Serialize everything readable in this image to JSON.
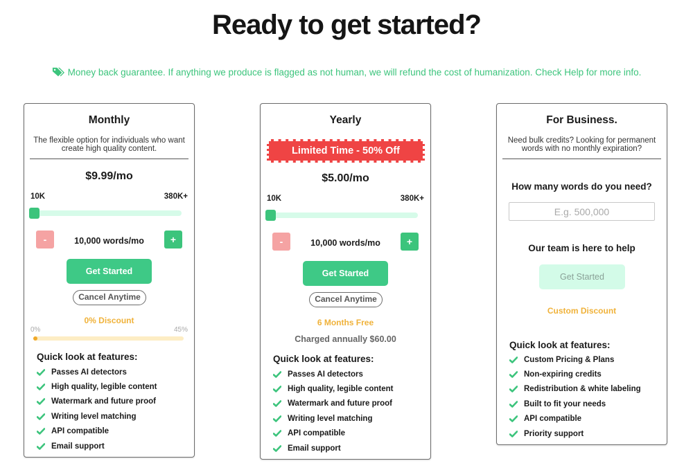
{
  "header": {
    "title": "Ready to get started?",
    "guarantee": "Money back guarantee. If anything we produce is flagged as not human, we will refund the cost of humanization. Check Help for more info.",
    "guarantee_icon": "tags-icon"
  },
  "colors": {
    "accent_green": "#3cc47c",
    "light_green": "#d6fbe9",
    "minus_red": "#f5a3a3",
    "banner_red": "#ef4444",
    "discount_orange": "#f0b23a"
  },
  "plans": {
    "monthly": {
      "title": "Monthly",
      "description": "The flexible option for individuals who want create high quality content.",
      "price": "$9.99/mo",
      "range_min": "10K",
      "range_max": "380K+",
      "slider_value_fraction": 0,
      "minus_label": "-",
      "plus_label": "+",
      "words": "10,000 words/mo",
      "cta": "Get Started",
      "cancel": "Cancel Anytime",
      "discount": "0% Discount",
      "discount_min": "0%",
      "discount_max": "45%",
      "discount_fraction": 0,
      "features_title": "Quick look at features:",
      "features": [
        "Passes AI detectors",
        "High quality, legible content",
        "Watermark and future proof",
        "Writing level matching",
        "API compatible",
        "Email support"
      ]
    },
    "yearly": {
      "title": "Yearly",
      "banner": "Limited Time - 50% Off",
      "price": "$5.00/mo",
      "range_min": "10K",
      "range_max": "380K+",
      "slider_value_fraction": 0,
      "minus_label": "-",
      "plus_label": "+",
      "words": "10,000 words/mo",
      "cta": "Get Started",
      "cancel": "Cancel Anytime",
      "bonus": "6 Months Free",
      "charged": "Charged annually $60.00",
      "features_title": "Quick look at features:",
      "features": [
        "Passes AI detectors",
        "High quality, legible content",
        "Watermark and future proof",
        "Writing level matching",
        "API compatible",
        "Email support"
      ]
    },
    "business": {
      "title": "For Business.",
      "description": "Need bulk credits? Looking for permanent words with no monthly expiration?",
      "question": "How many words do you need?",
      "input_value": "",
      "input_placeholder": "E.g. 500,000",
      "help": "Our team is here to help",
      "cta": "Get Started",
      "discount": "Custom Discount",
      "features_title": "Quick look at features:",
      "features": [
        "Custom Pricing & Plans",
        "Non-expiring credits",
        "Redistribution & white labeling",
        "Built to fit your needs",
        "API compatible",
        "Priority support"
      ]
    }
  }
}
